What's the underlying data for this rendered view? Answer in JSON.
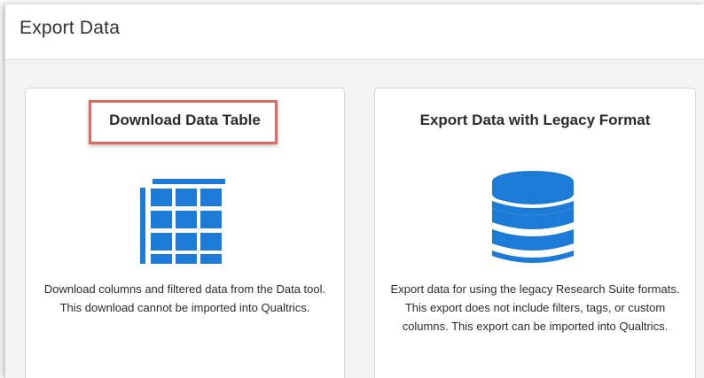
{
  "dialog": {
    "title": "Export Data"
  },
  "cards": [
    {
      "title": "Download Data Table",
      "icon": "table-grid-icon",
      "description": "Download columns and filtered data from the Data tool. This download cannot be imported into Qualtrics.",
      "highlighted": true
    },
    {
      "title": "Export Data with Legacy Format",
      "icon": "database-icon",
      "description": "Export data for using the legacy Research Suite formats. This export does not include filters, tags, or custom columns. This export can be imported into Qualtrics.",
      "highlighted": false
    }
  ],
  "colors": {
    "icon_blue": "#1b7bd6",
    "highlight_red": "#d96b63",
    "body_bg": "#f4f4f4"
  }
}
